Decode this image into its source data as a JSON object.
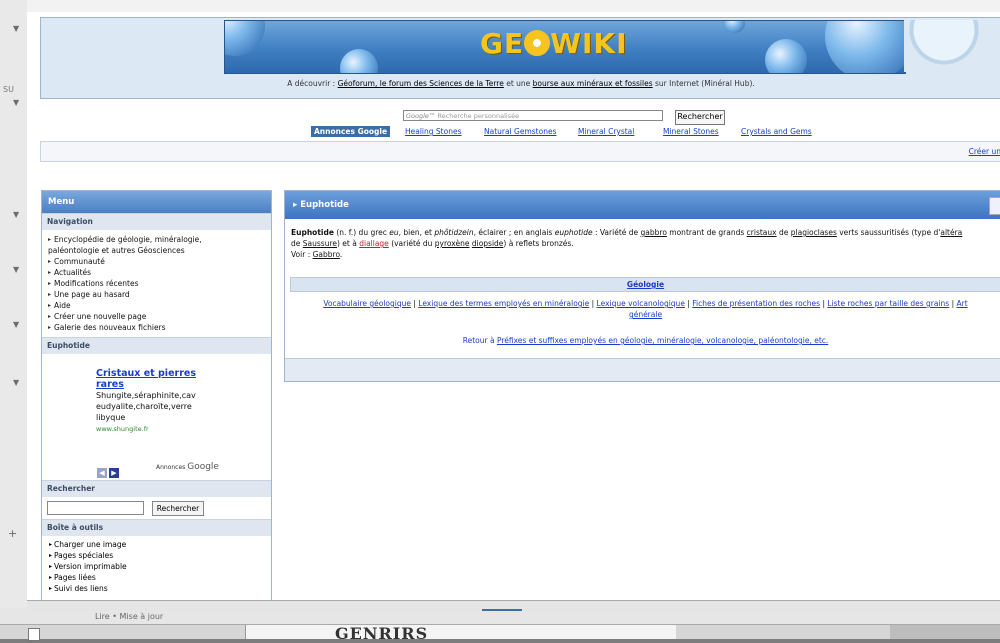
{
  "background": {
    "left_label": "SU",
    "bottom_label": "Lire • Mise à jour",
    "bottom_ghost_text": "GENRIRS",
    "plus": "+"
  },
  "header": {
    "logo": [
      "GE",
      "WIKI"
    ],
    "tagline_prefix": "A découvrir : ",
    "tagline_link1": "Géoforum, le forum des Sciences de la Terre",
    "tagline_mid": " et une ",
    "tagline_link2": "bourse aux minéraux et fossiles",
    "tagline_suffix": " sur Internet (Minéral Hub)."
  },
  "search": {
    "placeholder": "Recherche personnalisée",
    "google": "Google™",
    "button": "Rechercher"
  },
  "ads": {
    "label": "Annonces Google",
    "links": [
      "Healing Stones",
      "Natural Gemstones",
      "Mineral Crystal",
      "Mineral Stones",
      "Crystals and Gems"
    ]
  },
  "infobar": {
    "create": "Créer un"
  },
  "sidebar": {
    "title": "Menu",
    "nav_heading": "Navigation",
    "nav_items": [
      "Encyclopédie de géologie, minéralogie,",
      "paléontologie et autres Géosciences",
      "Communauté",
      "Actualités",
      "Modifications récentes",
      "Une page au hasard",
      "Aide",
      "Créer une nouvelle page",
      "Galerie des nouveaux fichiers"
    ],
    "page_heading": "Euphotide",
    "ad": {
      "title1": "Cristaux et pierres",
      "title2": "rares",
      "line1": "Shungite,séraphinite,cav",
      "line2": "eudyalite,charoïte,verre",
      "line3": "libyque",
      "url": "www.shungite.fr",
      "google_label": "Annonces",
      "google_logo": "Google"
    },
    "search_heading": "Rechercher",
    "search_button": "Rechercher",
    "tools_heading": "Boîte à outils",
    "tools": [
      "Charger une image",
      "Pages spéciales",
      "Version imprimable",
      "Pages liées",
      "Suivi des liens"
    ]
  },
  "article": {
    "title": "Euphotide",
    "term": "Euphotide",
    "p1": " (n. f.) du grec ",
    "eu": "eu",
    "p2": ", bien, et ",
    "photidzein": "phôtidzein",
    "p3": ", éclairer ; en anglais ",
    "euphotide_en": "euphotide",
    "p4": " : Variété de ",
    "gabbro": "gabbro",
    "p5": " montrant de grands ",
    "cristaux": "cristaux",
    "p6": " de ",
    "plagioclases": "plagioclases",
    "p7": " verts saussuritisés (type d'",
    "altera": "altéra",
    "p8": "de ",
    "saussure": "Saussure",
    "p9": ") et à ",
    "diallage": "diallage",
    "p10": " (variété du ",
    "pyroxene": "pyroxène",
    "p11": " ",
    "diopside": "diopside",
    "p12": ") à reflets bronzés.",
    "voir": "Voir : ",
    "gabbro2": "Gabbro",
    "dot": "."
  },
  "category": {
    "heading": "Géologie",
    "links": [
      "Vocabulaire géologique",
      "Lexique des termes employés en minéralogie",
      "Lexique volcanologique",
      "Fiches de présentation des roches",
      "Liste roches par taille des grains",
      "Art"
    ],
    "second_line": "générale",
    "retour_prefix": "Retour à ",
    "retour_link": "Préfixes et suffixes employés en géologie, minéralogie, volcanologie, paléontologie, etc."
  }
}
